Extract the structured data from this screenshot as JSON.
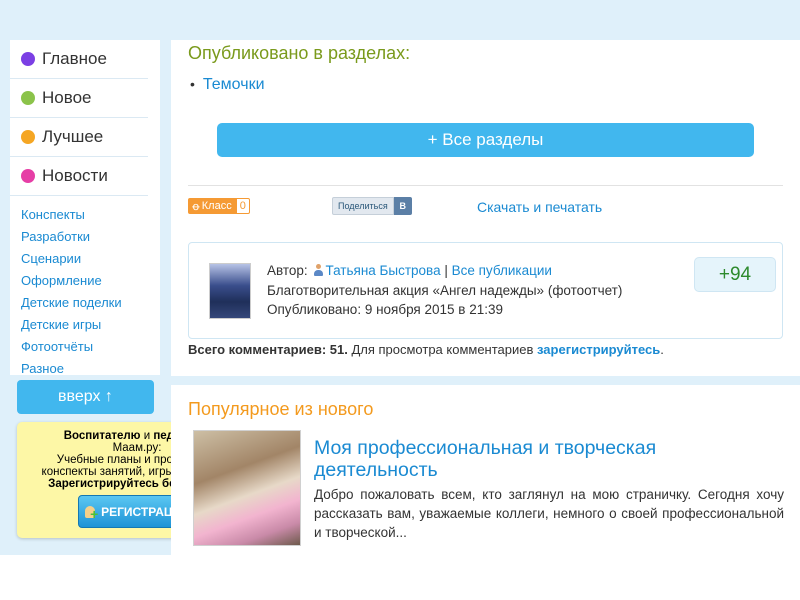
{
  "sidebar": {
    "main_items": [
      {
        "label": "Главное",
        "color": "#7b3fe4"
      },
      {
        "label": "Новое",
        "color": "#8bc34a"
      },
      {
        "label": "Лучшее",
        "color": "#f5a623"
      },
      {
        "label": "Новости",
        "color": "#e63ea6"
      }
    ],
    "links": [
      "Конспекты",
      "Разработки",
      "Сценарии",
      "Оформление",
      "Детские поделки",
      "Детские игры",
      "Фотоотчёты",
      "Разное"
    ],
    "up_button": "вверх ↑"
  },
  "promo": {
    "line1_bold_a": "Воспитателю",
    "line1_mid": " и ",
    "line1_bold_b": "педагогу",
    "line1_end": " -",
    "line2": "Маам.ру:",
    "line3": "Учебные планы и программы,",
    "line4": "конспекты занятий, игры, конкурсы.",
    "line5_bold": "Зарегистрируйтесь бесплатно!",
    "reg_button": "РЕГИСТРАЦИЯ"
  },
  "main": {
    "section_title": "Опубликовано в разделах:",
    "categories": [
      "Темочки"
    ],
    "all_sections_button": "+ Все разделы",
    "share": {
      "ok_label": "Класс",
      "ok_count": "0",
      "vk_label": "Поделиться",
      "vk_icon": "B",
      "download": "Скачать и печатать"
    },
    "author": {
      "prefix": "Автор:",
      "name": "Татьяна Быстрова",
      "divider": " | ",
      "all_pubs": "Все публикации",
      "title": "Благотворительная акция «Ангел надежды» (фотоотчет)",
      "published": "Опубликовано: 9 ноября 2015 в 21:39",
      "rating": "+94"
    },
    "comments": {
      "bold": "Всего комментариев: 51.",
      "text": " Для просмотра комментариев ",
      "link": "зарегистрируйтесь",
      "end": "."
    }
  },
  "popular": {
    "title": "Популярное из нового",
    "headline": "Моя профессиональная и творческая деятельность",
    "excerpt": "Добро пожаловать всем, кто заглянул на мою страничку. Сегодня хочу рассказать вам, уважаемые коллеги, немного о своей профессиональной и творческой..."
  }
}
